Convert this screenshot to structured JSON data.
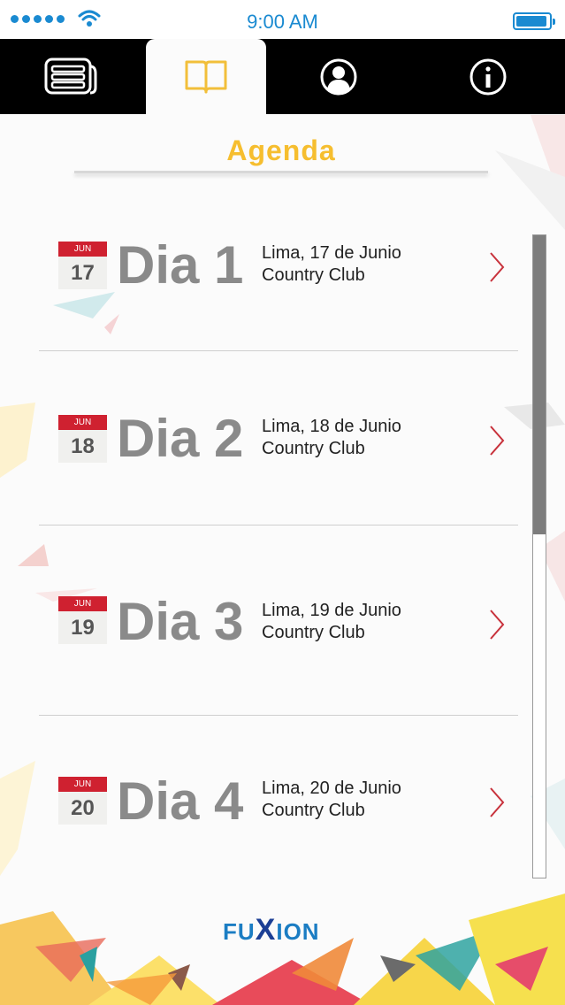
{
  "status_bar": {
    "time": "9:00 AM"
  },
  "tabs": [
    {
      "icon": "news-icon",
      "active": false
    },
    {
      "icon": "book-icon",
      "active": true
    },
    {
      "icon": "profile-icon",
      "active": false
    },
    {
      "icon": "info-icon",
      "active": false
    }
  ],
  "page": {
    "title": "Agenda"
  },
  "days": [
    {
      "month": "JUN",
      "date": "17",
      "title": "Dia 1",
      "line1": "Lima, 17 de Junio",
      "line2": "Country Club"
    },
    {
      "month": "JUN",
      "date": "18",
      "title": "Dia 2",
      "line1": "Lima, 18 de Junio",
      "line2": "Country Club"
    },
    {
      "month": "JUN",
      "date": "19",
      "title": "Dia 3",
      "line1": "Lima, 19 de Junio",
      "line2": "Country Club"
    },
    {
      "month": "JUN",
      "date": "20",
      "title": "Dia 4",
      "line1": "Lima, 20 de Junio",
      "line2": "Country Club"
    }
  ],
  "footer": {
    "logo_part1": "FU",
    "logo_part2": "X",
    "logo_part3": "ION"
  },
  "colors": {
    "accent_blue": "#1a8ad1",
    "title_yellow": "#f6be2f",
    "calendar_red": "#cf2130",
    "chevron_red": "#c8323c"
  }
}
